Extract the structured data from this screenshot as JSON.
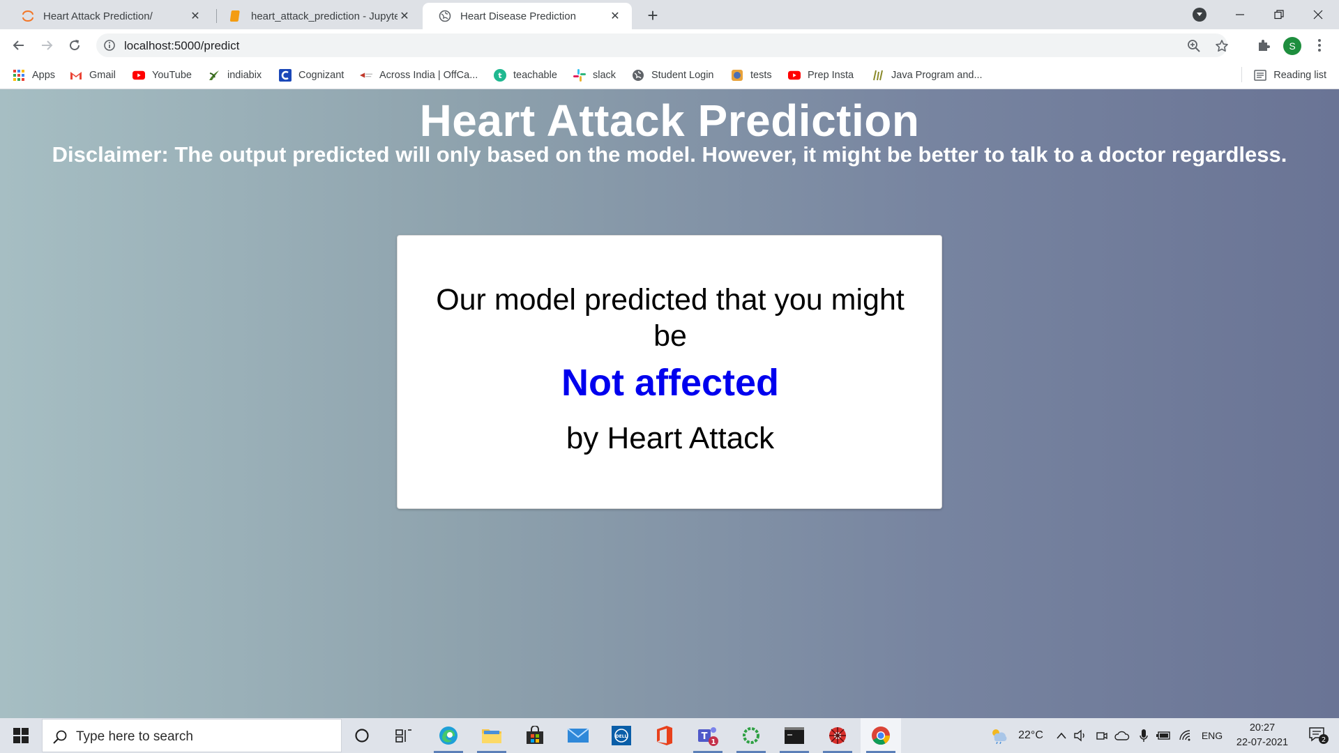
{
  "browser": {
    "tabs": [
      {
        "title": "Heart Attack Prediction/",
        "icon": "jupyter-icon",
        "active": false
      },
      {
        "title": "heart_attack_prediction - Jupyter",
        "icon": "notebook-icon",
        "active": false
      },
      {
        "title": "Heart Disease Prediction",
        "icon": "globe-icon",
        "active": true
      }
    ],
    "url": "localhost:5000/predict",
    "profile_initial": "S"
  },
  "bookmarks": [
    {
      "label": "Apps",
      "icon": "apps-grid-icon"
    },
    {
      "label": "Gmail",
      "icon": "gmail-icon"
    },
    {
      "label": "YouTube",
      "icon": "youtube-icon"
    },
    {
      "label": "indiabix",
      "icon": "indiabix-icon"
    },
    {
      "label": "Cognizant",
      "icon": "cognizant-icon"
    },
    {
      "label": "Across India | OffCa...",
      "icon": "offcampus-icon"
    },
    {
      "label": "teachable",
      "icon": "teachable-icon"
    },
    {
      "label": "slack",
      "icon": "slack-icon"
    },
    {
      "label": "Student Login",
      "icon": "globe-icon"
    },
    {
      "label": "tests",
      "icon": "tests-icon"
    },
    {
      "label": "Prep Insta",
      "icon": "youtube-icon"
    },
    {
      "label": "Java Program and...",
      "icon": "java-icon"
    }
  ],
  "reading_list": "Reading list",
  "page": {
    "title": "Heart Attack Prediction",
    "disclaimer": "Disclaimer: The output predicted will only based on the model. However, it might be better to talk to a doctor regardless.",
    "result_card": {
      "line1": "Our model predicted that you might be",
      "result": "Not affected",
      "result_color": "#0000ee",
      "line3": "by Heart Attack"
    }
  },
  "taskbar": {
    "search_placeholder": "Type here to search",
    "weather": "22°C",
    "language": "ENG",
    "time": "20:27",
    "date": "22-07-2021",
    "notification_count": "2",
    "teams_badge": "1"
  }
}
